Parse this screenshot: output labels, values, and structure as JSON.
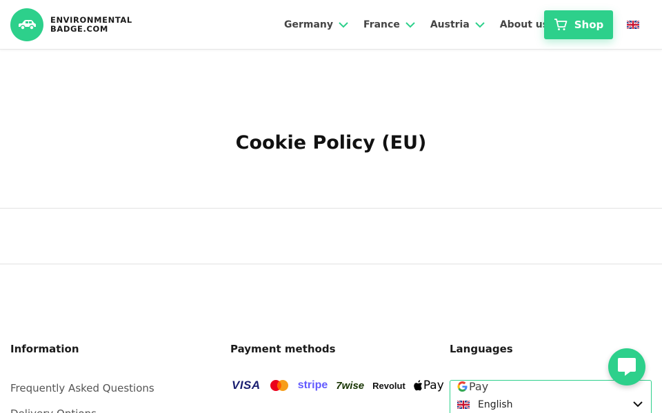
{
  "header": {
    "logo_line1": "ENVIRONMENTAL",
    "logo_line2": "BADGE.COM",
    "nav": [
      {
        "label": "Germany",
        "has_dropdown": true
      },
      {
        "label": "France",
        "has_dropdown": true
      },
      {
        "label": "Austria",
        "has_dropdown": true
      },
      {
        "label": "About us",
        "has_dropdown": false
      }
    ],
    "shop_label": "Shop",
    "accent_color": "#2dd08b"
  },
  "main": {
    "title": "Cookie Policy (EU)"
  },
  "footer": {
    "information": {
      "heading": "Information",
      "links": [
        "Frequently Asked Questions",
        "Delivery Options"
      ]
    },
    "payment": {
      "heading": "Payment methods",
      "methods": [
        "VISA",
        "Mastercard",
        "stripe",
        "7wise",
        "Revolut",
        "Pay",
        "Pay"
      ]
    },
    "languages": {
      "heading": "Languages",
      "selected": "English"
    }
  },
  "icons": [
    "car-icon",
    "chevron-down-icon",
    "cart-icon",
    "uk-flag-icon",
    "chat-icon",
    "apple-icon",
    "google-g-icon"
  ]
}
